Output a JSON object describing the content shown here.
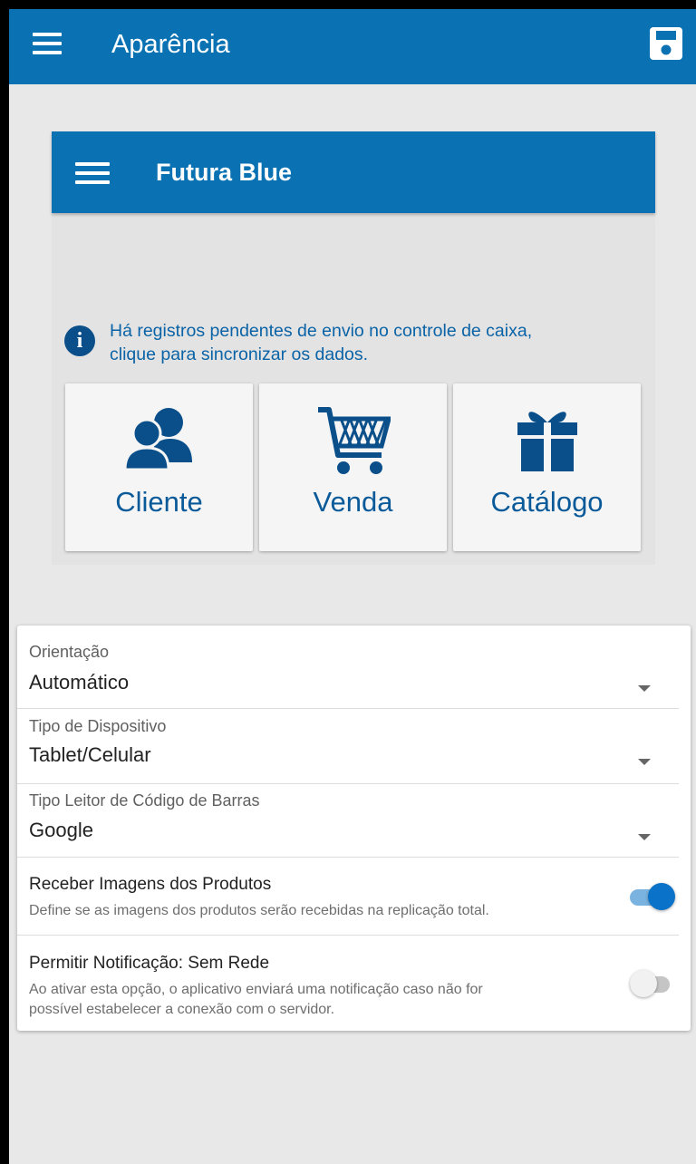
{
  "appbar": {
    "title": "Aparência",
    "menu_icon": "menu-icon",
    "save_icon": "save-icon"
  },
  "preview": {
    "title": "Futura Blue",
    "notice": {
      "line1": "Há registros pendentes de envio no controle de caixa,",
      "line2": "clique para sincronizar os dados.",
      "icon_glyph": "i"
    },
    "tiles": [
      {
        "label": "Cliente",
        "icon": "users-icon"
      },
      {
        "label": "Venda",
        "icon": "cart-icon"
      },
      {
        "label": "Catálogo",
        "icon": "gift-icon"
      }
    ]
  },
  "settings": {
    "orientation": {
      "label": "Orientação",
      "value": "Automático"
    },
    "device_type": {
      "label": "Tipo de Dispositivo",
      "value": "Tablet/Celular"
    },
    "barcode_reader": {
      "label": "Tipo Leitor de Código de Barras",
      "value": "Google"
    },
    "receive_images": {
      "title": "Receber Imagens dos Produtos",
      "description": "Define se as imagens dos produtos serão recebidas na replicação total.",
      "enabled": true
    },
    "notify_no_network": {
      "title": "Permitir Notificação: Sem Rede",
      "description_line1": "Ao ativar esta opção, o aplicativo enviará uma notificação caso não for",
      "description_line2": "possível estabelecer a conexão com o servidor.",
      "enabled": false
    }
  },
  "colors": {
    "primary": "#0a72b3",
    "accent_dark": "#0a5a9a",
    "background": "#e8e8e8"
  }
}
